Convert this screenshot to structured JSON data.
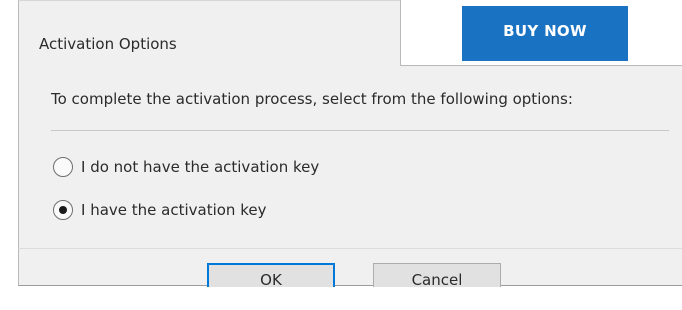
{
  "dialog": {
    "title": "Activation Options",
    "intro": "To complete the activation process, select from the following options:",
    "options": [
      {
        "label": "I do not have the activation key",
        "selected": false
      },
      {
        "label": "I have the activation key",
        "selected": true
      }
    ],
    "buttons": {
      "ok": "OK",
      "cancel": "Cancel"
    }
  },
  "background_window": {
    "buy_now_label": "BUY NOW",
    "buy_now_color": "#1a73c2"
  },
  "colors": {
    "dialog_bg": "#f0f0f0",
    "focus_border": "#0078d7"
  }
}
